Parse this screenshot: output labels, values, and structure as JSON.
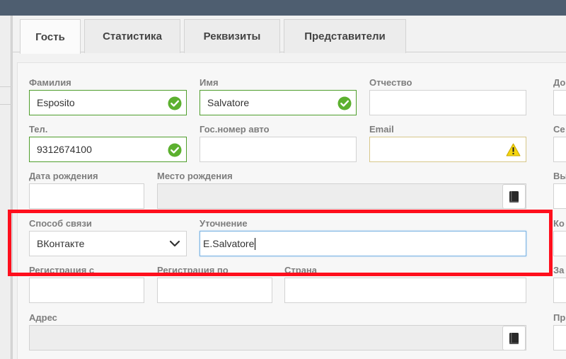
{
  "tabs": [
    {
      "label": "Гость"
    },
    {
      "label": "Статистика"
    },
    {
      "label": "Реквизиты"
    },
    {
      "label": "Представители"
    }
  ],
  "active_tab": "Гость",
  "form": {
    "surname": {
      "label": "Фамилия",
      "value": "Esposito",
      "status": "valid"
    },
    "name": {
      "label": "Имя",
      "value": "Salvatore",
      "status": "valid"
    },
    "patronymic": {
      "label": "Отчество",
      "value": ""
    },
    "phone": {
      "label": "Тел.",
      "value": "9312674100",
      "status": "valid"
    },
    "car_plate": {
      "label": "Гос.номер авто",
      "value": ""
    },
    "email": {
      "label": "Email",
      "value": "",
      "status": "warning"
    },
    "birth_date": {
      "label": "Дата рождения",
      "value": ""
    },
    "birth_place": {
      "label": "Место рождения",
      "value": ""
    },
    "contact_method": {
      "label": "Способ связи",
      "selected": "ВКонтакте"
    },
    "clarification": {
      "label": "Уточнение",
      "value": "E.Salvatore"
    },
    "reg_from": {
      "label": "Регистрация с",
      "value": ""
    },
    "reg_to": {
      "label": "Регистрация по",
      "value": ""
    },
    "country": {
      "label": "Страна",
      "value": ""
    },
    "address": {
      "label": "Адрес",
      "value": ""
    }
  },
  "right_column_labels": [
    "До",
    "Се",
    "Вы",
    "Ко",
    "За",
    "Пр"
  ],
  "colors": {
    "valid_border": "#4f9e2c",
    "valid_icon": "#5cb02f",
    "warning_icon": "#f5d60e",
    "focus_border": "#7db4e3",
    "highlight_box": "#ff0f1d",
    "titlebar": "#4e5e70"
  },
  "icons": {
    "valid": "check-circle-icon",
    "warning": "warning-triangle-icon",
    "lookup": "book-icon",
    "dropdown": "chevron-down-icon"
  }
}
